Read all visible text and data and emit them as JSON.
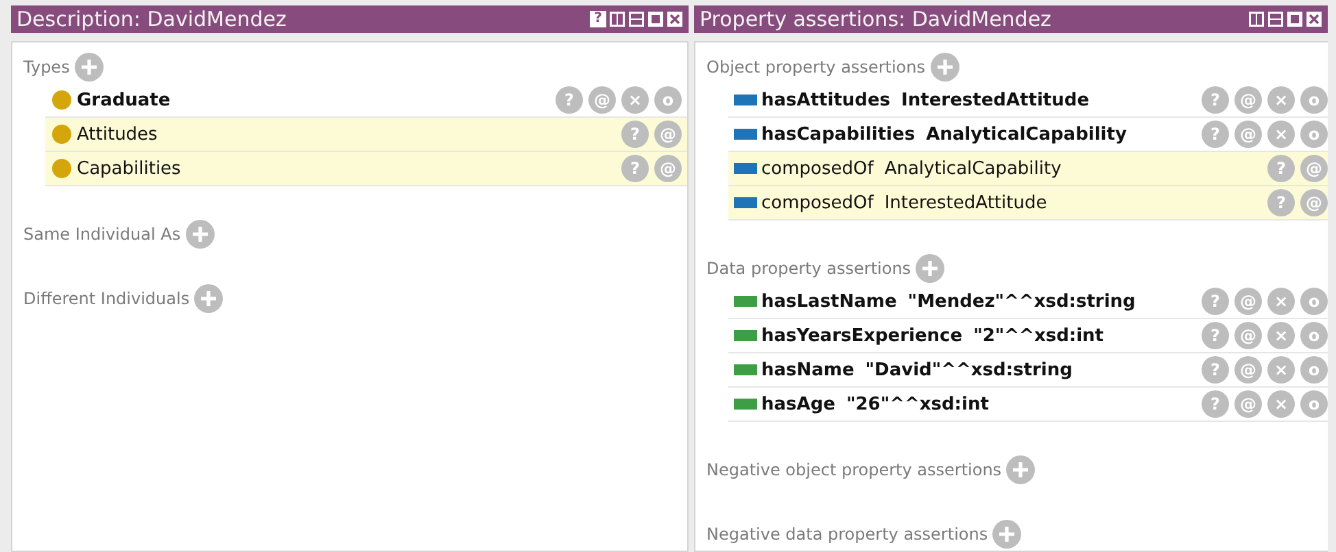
{
  "panels": [
    {
      "title": "Description: DavidMendez",
      "view_buttons": [
        {
          "kind": "help",
          "label": "?"
        },
        {
          "kind": "split-vertical"
        },
        {
          "kind": "split-horizontal"
        },
        {
          "kind": "maximize"
        },
        {
          "kind": "close"
        }
      ],
      "sections": [
        {
          "header": "Types",
          "kind": "class",
          "rows": [
            {
              "name": "Graduate",
              "inferred": false,
              "actions": [
                "?",
                "@",
                "×",
                "o"
              ]
            },
            {
              "name": "Attitudes",
              "inferred": true,
              "actions": [
                "?",
                "@"
              ]
            },
            {
              "name": "Capabilities",
              "inferred": true,
              "actions": [
                "?",
                "@"
              ]
            }
          ]
        },
        {
          "header": "Same Individual As"
        },
        {
          "header": "Different Individuals"
        }
      ]
    },
    {
      "title": "Property assertions: DavidMendez",
      "view_buttons": [
        {
          "kind": "split-vertical"
        },
        {
          "kind": "split-horizontal"
        },
        {
          "kind": "maximize"
        },
        {
          "kind": "close"
        }
      ],
      "sections": [
        {
          "header": "Object property assertions",
          "kind": "object",
          "rows": [
            {
              "name": "hasAttitudes",
              "value": "InterestedAttitude",
              "inferred": false,
              "actions": [
                "?",
                "@",
                "×",
                "o"
              ]
            },
            {
              "name": "hasCapabilities",
              "value": "AnalyticalCapability",
              "inferred": false,
              "actions": [
                "?",
                "@",
                "×",
                "o"
              ]
            },
            {
              "name": "composedOf",
              "value": "AnalyticalCapability",
              "inferred": true,
              "actions": [
                "?",
                "@"
              ]
            },
            {
              "name": "composedOf",
              "value": "InterestedAttitude",
              "inferred": true,
              "actions": [
                "?",
                "@"
              ]
            }
          ]
        },
        {
          "header": "Data property assertions",
          "kind": "data",
          "rows": [
            {
              "name": "hasLastName",
              "value": "\"Mendez\"^^xsd:string",
              "inferred": false,
              "actions": [
                "?",
                "@",
                "×",
                "o"
              ]
            },
            {
              "name": "hasYearsExperience",
              "value": "\"2\"^^xsd:int",
              "inferred": false,
              "actions": [
                "?",
                "@",
                "×",
                "o"
              ]
            },
            {
              "name": "hasName",
              "value": "\"David\"^^xsd:string",
              "inferred": false,
              "actions": [
                "?",
                "@",
                "×",
                "o"
              ]
            },
            {
              "name": "hasAge",
              "value": "\"26\"^^xsd:int",
              "inferred": false,
              "actions": [
                "?",
                "@",
                "×",
                "o"
              ]
            }
          ]
        },
        {
          "header": "Negative object property assertions"
        },
        {
          "header": "Negative data property assertions"
        }
      ]
    }
  ]
}
